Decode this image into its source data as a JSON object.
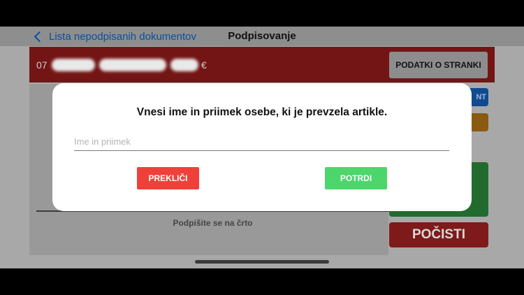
{
  "nav": {
    "back_label": "Lista nepodpisanih dokumentov",
    "title": "Podpisovanje"
  },
  "header": {
    "prefix": "07",
    "suffix": "€",
    "customer_button": "PODATKI O STRANKI"
  },
  "side": {
    "blue_button_partial": "NT",
    "clear_button": "POČISTI"
  },
  "signature": {
    "hint": "Podpišite se na črto"
  },
  "dialog": {
    "title": "Vnesi ime in priimek osebe, ki je prevzela artikle.",
    "input_placeholder": "Ime in priimek",
    "input_value": "",
    "cancel_label": "PREKLIČI",
    "confirm_label": "POTRDI"
  },
  "colors": {
    "header_red": "#c62828",
    "cancel_red": "#f0403a",
    "confirm_green": "#4cd66b",
    "link_blue": "#1a73e8"
  }
}
